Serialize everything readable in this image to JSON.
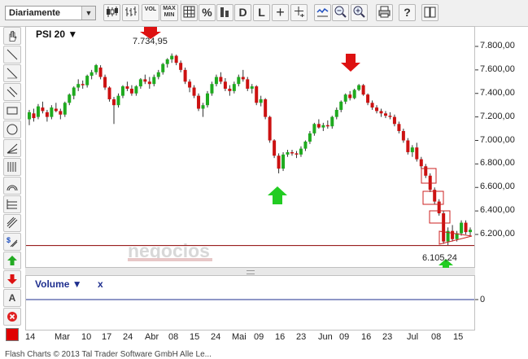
{
  "toolbar": {
    "period_select": "Diariamente",
    "buttons": [
      {
        "name": "candlestick-chart-button",
        "label": "",
        "icon": "candlestick-icon"
      },
      {
        "name": "ohlc-chart-button",
        "label": "",
        "icon": "ohlc-bars-icon"
      },
      {
        "name": "volume-button",
        "label": "VOL"
      },
      {
        "name": "max-min-button",
        "label": "MAX MIN"
      },
      {
        "name": "grid-button",
        "label": "",
        "icon": "grid-icon"
      },
      {
        "name": "percent-button",
        "label": "%"
      },
      {
        "name": "bar-chart-button",
        "label": "",
        "icon": "bar-chart-icon"
      },
      {
        "name": "d-button",
        "label": "D"
      },
      {
        "name": "l-button",
        "label": "L"
      },
      {
        "name": "crosshair-button",
        "label": "+"
      },
      {
        "name": "crosshair-value-button",
        "label": "",
        "icon": "crosshair-value-icon"
      },
      {
        "name": "trend-zoom-button",
        "label": "",
        "icon": "trend-icon"
      },
      {
        "name": "zoom-out-button",
        "label": "",
        "icon": "zoom-out-icon"
      },
      {
        "name": "zoom-in-button",
        "label": "",
        "icon": "zoom-in-icon"
      },
      {
        "name": "print-button",
        "label": "",
        "icon": "printer-icon"
      },
      {
        "name": "help-button",
        "label": "?"
      },
      {
        "name": "book-button",
        "label": "",
        "icon": "book-icon"
      }
    ]
  },
  "tools": [
    "hand-icon",
    "line-icon",
    "horizontal-line-icon",
    "parallel-lines-icon",
    "rectangle-icon",
    "circle-icon",
    "fan-icon",
    "fibonacci-icon",
    "arc-icon",
    "channel-icon",
    "regression-icon",
    "dollar-icon",
    "arrow-up-icon",
    "arrow-down-icon",
    "text-icon",
    "delete-icon"
  ],
  "tool_labels": {
    "text": "A",
    "dollar": "$"
  },
  "chart": {
    "title": "PSI 20 ▼",
    "max_label": "7.734,95",
    "min_label": "6.105,24",
    "watermark": "negocios",
    "y_ticks": [
      "7.800,00",
      "7.600,00",
      "7.400,00",
      "7.200,00",
      "7.000,00",
      "6.800,00",
      "6.600,00",
      "6.400,00",
      "6.200,00"
    ],
    "x_ticks": [
      "14",
      "Mar",
      "10",
      "17",
      "24",
      "Abr",
      "08",
      "15",
      "24",
      "Mai",
      "09",
      "16",
      "23",
      "Jun",
      "09",
      "16",
      "23",
      "Jul",
      "08",
      "15"
    ],
    "colors": {
      "up": "#1faa1f",
      "down": "#cc1111",
      "support_line": "#8b0000",
      "arrow_up": "#22cc22",
      "arrow_down": "#dd1111"
    }
  },
  "chart_data": {
    "type": "candlestick",
    "title": "PSI 20",
    "ylim": [
      6080,
      7900
    ],
    "ohlc": [
      [
        7180,
        7260,
        7130,
        7240
      ],
      [
        7230,
        7270,
        7160,
        7190
      ],
      [
        7200,
        7310,
        7180,
        7290
      ],
      [
        7280,
        7330,
        7230,
        7250
      ],
      [
        7240,
        7260,
        7160,
        7200
      ],
      [
        7200,
        7300,
        7180,
        7280
      ],
      [
        7270,
        7320,
        7240,
        7250
      ],
      [
        7250,
        7270,
        7180,
        7220
      ],
      [
        7220,
        7330,
        7200,
        7320
      ],
      [
        7320,
        7400,
        7300,
        7390
      ],
      [
        7380,
        7460,
        7350,
        7450
      ],
      [
        7450,
        7520,
        7420,
        7480
      ],
      [
        7480,
        7510,
        7440,
        7470
      ],
      [
        7470,
        7560,
        7450,
        7550
      ],
      [
        7550,
        7600,
        7520,
        7580
      ],
      [
        7580,
        7650,
        7560,
        7640
      ],
      [
        7620,
        7640,
        7520,
        7540
      ],
      [
        7540,
        7560,
        7430,
        7450
      ],
      [
        7450,
        7460,
        7330,
        7350
      ],
      [
        7350,
        7370,
        7140,
        7300
      ],
      [
        7300,
        7400,
        7280,
        7380
      ],
      [
        7380,
        7470,
        7360,
        7460
      ],
      [
        7460,
        7500,
        7420,
        7440
      ],
      [
        7440,
        7470,
        7380,
        7400
      ],
      [
        7400,
        7470,
        7380,
        7460
      ],
      [
        7460,
        7530,
        7440,
        7520
      ],
      [
        7520,
        7560,
        7480,
        7500
      ],
      [
        7500,
        7540,
        7440,
        7480
      ],
      [
        7480,
        7560,
        7460,
        7540
      ],
      [
        7540,
        7600,
        7520,
        7580
      ],
      [
        7580,
        7660,
        7560,
        7650
      ],
      [
        7650,
        7700,
        7620,
        7690
      ],
      [
        7690,
        7740,
        7660,
        7720
      ],
      [
        7720,
        7730,
        7640,
        7660
      ],
      [
        7660,
        7680,
        7580,
        7600
      ],
      [
        7600,
        7620,
        7480,
        7500
      ],
      [
        7500,
        7520,
        7410,
        7450
      ],
      [
        7450,
        7470,
        7360,
        7380
      ],
      [
        7380,
        7400,
        7250,
        7270
      ],
      [
        7270,
        7320,
        7200,
        7300
      ],
      [
        7300,
        7420,
        7280,
        7400
      ],
      [
        7400,
        7500,
        7380,
        7480
      ],
      [
        7480,
        7560,
        7460,
        7540
      ],
      [
        7540,
        7580,
        7480,
        7500
      ],
      [
        7500,
        7530,
        7420,
        7440
      ],
      [
        7440,
        7470,
        7380,
        7420
      ],
      [
        7420,
        7500,
        7400,
        7480
      ],
      [
        7480,
        7560,
        7460,
        7540
      ],
      [
        7540,
        7600,
        7500,
        7520
      ],
      [
        7520,
        7540,
        7420,
        7440
      ],
      [
        7440,
        7480,
        7400,
        7460
      ],
      [
        7460,
        7470,
        7300,
        7320
      ],
      [
        7320,
        7380,
        7290,
        7350
      ],
      [
        7350,
        7360,
        7180,
        7200
      ],
      [
        7200,
        7210,
        6980,
        7000
      ],
      [
        7000,
        7010,
        6850,
        6870
      ],
      [
        6870,
        6890,
        6720,
        6760
      ],
      [
        6760,
        6900,
        6740,
        6880
      ],
      [
        6880,
        6920,
        6860,
        6900
      ],
      [
        6900,
        6920,
        6870,
        6890
      ],
      [
        6890,
        6910,
        6850,
        6880
      ],
      [
        6880,
        6950,
        6860,
        6930
      ],
      [
        6930,
        7000,
        6910,
        6990
      ],
      [
        6990,
        7080,
        6970,
        7060
      ],
      [
        7060,
        7150,
        7040,
        7140
      ],
      [
        7140,
        7180,
        7100,
        7110
      ],
      [
        7110,
        7150,
        7080,
        7130
      ],
      [
        7130,
        7170,
        7100,
        7120
      ],
      [
        7120,
        7210,
        7100,
        7200
      ],
      [
        7200,
        7280,
        7180,
        7260
      ],
      [
        7260,
        7340,
        7240,
        7330
      ],
      [
        7330,
        7400,
        7310,
        7390
      ],
      [
        7390,
        7420,
        7340,
        7360
      ],
      [
        7360,
        7440,
        7350,
        7430
      ],
      [
        7430,
        7480,
        7420,
        7470
      ],
      [
        7470,
        7480,
        7380,
        7390
      ],
      [
        7390,
        7400,
        7300,
        7320
      ],
      [
        7320,
        7340,
        7260,
        7280
      ],
      [
        7280,
        7300,
        7230,
        7250
      ],
      [
        7250,
        7270,
        7200,
        7230
      ],
      [
        7230,
        7250,
        7190,
        7210
      ],
      [
        7210,
        7240,
        7180,
        7200
      ],
      [
        7200,
        7220,
        7120,
        7140
      ],
      [
        7140,
        7160,
        7060,
        7080
      ],
      [
        7080,
        7100,
        6980,
        7000
      ],
      [
        7000,
        7020,
        6880,
        6900
      ],
      [
        6900,
        6960,
        6860,
        6940
      ],
      [
        6940,
        6980,
        6820,
        6840
      ],
      [
        6840,
        6860,
        6760,
        6780
      ],
      [
        6780,
        6800,
        6680,
        6700
      ],
      [
        6700,
        6720,
        6560,
        6580
      ],
      [
        6580,
        6600,
        6460,
        6480
      ],
      [
        6480,
        6500,
        6360,
        6380
      ],
      [
        6380,
        6400,
        6120,
        6140
      ],
      [
        6140,
        6260,
        6110,
        6230
      ],
      [
        6230,
        6280,
        6140,
        6160
      ],
      [
        6160,
        6230,
        6140,
        6210
      ],
      [
        6210,
        6320,
        6190,
        6300
      ],
      [
        6300,
        6320,
        6200,
        6220
      ],
      [
        6220,
        6260,
        6190,
        6240
      ]
    ],
    "x_ticks": [
      "14",
      "Mar",
      "10",
      "17",
      "24",
      "Abr",
      "08",
      "15",
      "24",
      "Mai",
      "09",
      "16",
      "23",
      "Jun",
      "09",
      "16",
      "23",
      "Jul",
      "08",
      "15"
    ],
    "support_level": 6105.24,
    "max_value": 7734.95,
    "min_value": 6105.24
  },
  "volume_panel": {
    "title": "Volume ▼",
    "close_label": "x",
    "y_tick": "0"
  },
  "footer": "Flash Charts © 2013 Tal Trader Software GmbH Alle Le..."
}
